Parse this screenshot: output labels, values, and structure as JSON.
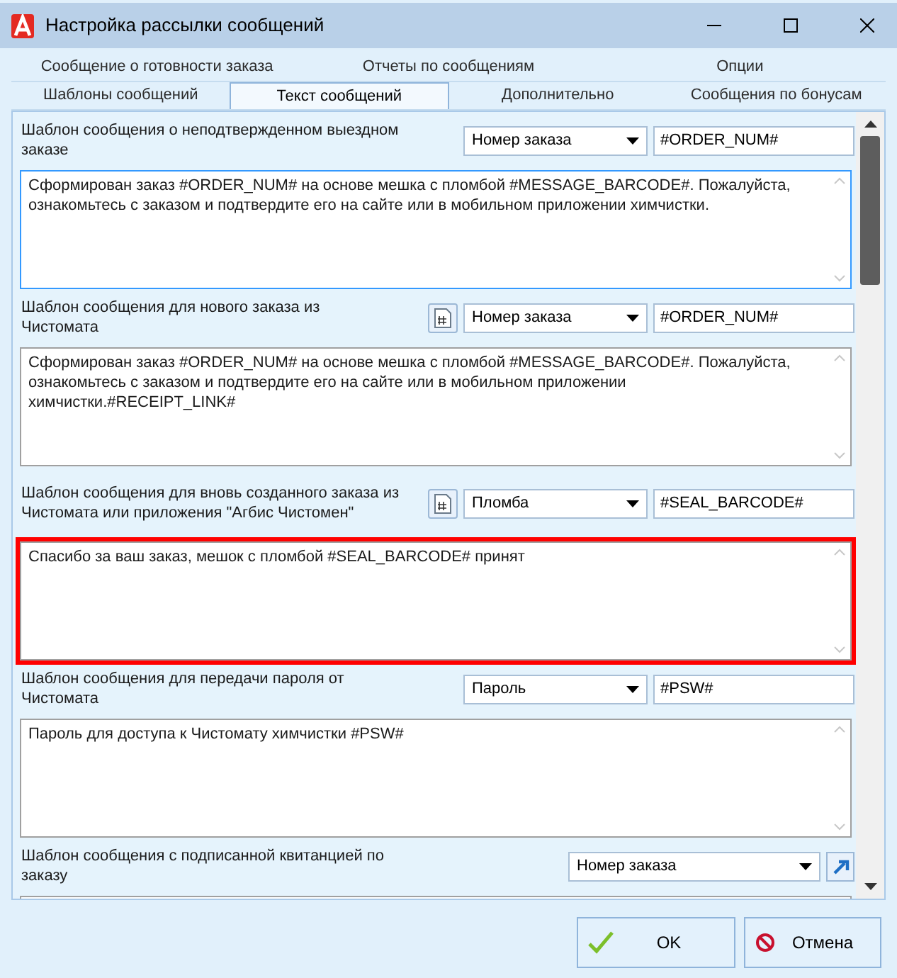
{
  "window": {
    "title": "Настройка рассылки сообщений"
  },
  "tab_rows": [
    {
      "tabs": [
        {
          "label": "Сообщение о готовности заказа",
          "selected": false
        },
        {
          "label": "Отчеты по сообщениям",
          "selected": false
        },
        {
          "label": "Опции",
          "selected": false
        }
      ]
    },
    {
      "tabs": [
        {
          "label": "Шаблоны сообщений",
          "selected": false
        },
        {
          "label": "Текст сообщений",
          "selected": true
        },
        {
          "label": "Дополнительно",
          "selected": false
        },
        {
          "label": "Сообщения по бонусам",
          "selected": false
        }
      ]
    }
  ],
  "sections": [
    {
      "label": "Шаблон сообщения о неподтвержденном выездном заказе",
      "insert_button": false,
      "link_button": false,
      "field": "Номер заказа",
      "token": "#ORDER_NUM#",
      "message": {
        "value": "Сформирован заказ #ORDER_NUM# на основе мешка с пломбой #MESSAGE_BARCODE#. Пожалуйста, ознакомьтесь с заказом и подтвердите его на сайте или в мобильном приложении химчистки.",
        "focused": true,
        "highlighted": false
      }
    },
    {
      "label": "Шаблон сообщения для нового заказа из Чистомата",
      "insert_button": true,
      "link_button": false,
      "field": "Номер заказа",
      "token": "#ORDER_NUM#",
      "message": {
        "value": "Сформирован заказ #ORDER_NUM# на основе мешка с пломбой #MESSAGE_BARCODE#. Пожалуйста, ознакомьтесь с заказом и подтвердите его на сайте или в мобильном приложении химчистки.#RECEIPT_LINK#",
        "focused": false,
        "highlighted": false
      }
    },
    {
      "label": "Шаблон сообщения для вновь созданного заказа из Чистомата или приложения \"Агбис Чистомен\"",
      "insert_button": true,
      "link_button": false,
      "field": "Пломба",
      "token": "#SEAL_BARCODE#",
      "message": {
        "value": "Спасибо за ваш заказ, мешок с пломбой #SEAL_BARCODE# принят",
        "focused": false,
        "highlighted": true
      }
    },
    {
      "label": "Шаблон сообщения для передачи пароля от Чистомата",
      "insert_button": false,
      "link_button": false,
      "field": "Пароль",
      "token": "#PSW#",
      "message": {
        "value": "Пароль для доступа к Чистомату химчистки #PSW#",
        "focused": false,
        "highlighted": false
      }
    },
    {
      "label": "Шаблон сообщения с подписанной квитанцией по заказу",
      "insert_button": false,
      "link_button": true,
      "field": "Номер заказа",
      "message": {
        "focused": false,
        "highlighted": false
      }
    }
  ],
  "buttons": [
    {
      "kind": "ok",
      "label": "OK"
    },
    {
      "kind": "cancel",
      "label": "Отмена"
    }
  ]
}
